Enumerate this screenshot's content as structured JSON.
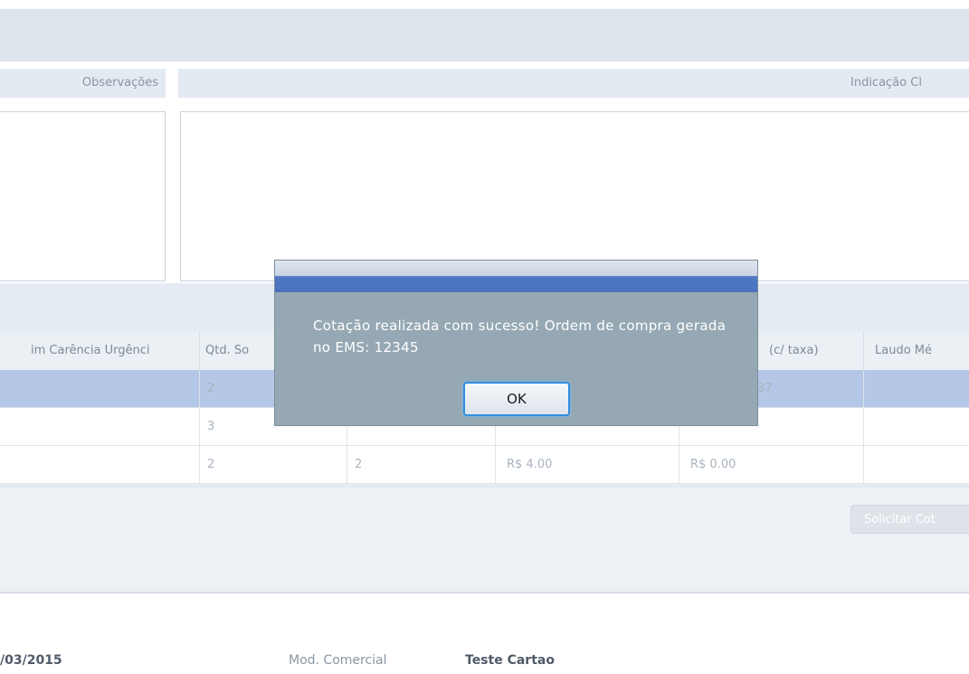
{
  "panels": {
    "observacoes_label": "Observações",
    "indicacao_label": "Indicação Cl"
  },
  "grid": {
    "columns": [
      "im Carência Urgênci",
      "Qtd. So",
      "",
      "",
      "(c/ taxa)",
      "Laudo Mé"
    ],
    "rows": [
      {
        "c1": "",
        "qtd_sol": "2",
        "c3": "",
        "c4": "",
        "c5": "37",
        "c6": ""
      },
      {
        "c1": "",
        "qtd_sol": "3",
        "c3": "",
        "c4": "",
        "c5": "",
        "c6": ""
      },
      {
        "c1": "",
        "qtd_sol": "2",
        "c3": "2",
        "c4": "R$ 4.00",
        "c5": "R$ 0.00",
        "c6": ""
      }
    ]
  },
  "action_button_label": "Solicitar Cot",
  "footer": {
    "date": "/03/2015",
    "mod_label": "Mod. Comercial",
    "mod_value": "Teste Cartao"
  },
  "dialog": {
    "message": "Cotação realizada com sucesso! Ordem de compra gerada no EMS: 12345",
    "ok_label": "OK"
  },
  "colors": {
    "dialog_body": "#95a8b3",
    "dialog_title_bar": "#4a72bf",
    "selected_row": "#b5c7e7",
    "ok_focus_border": "#2f8de0"
  }
}
